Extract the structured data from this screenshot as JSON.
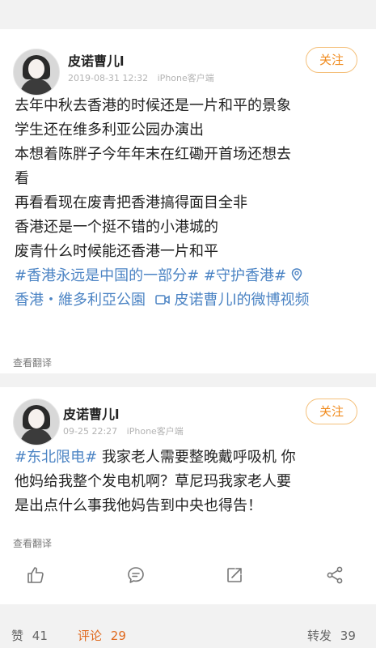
{
  "post1": {
    "username": "皮诺曹儿l",
    "timestamp": "2019-08-31 12:32",
    "client": "iPhone客户端",
    "follow_label": "关注",
    "lines": [
      "去年中秋去香港的时候还是一片和平的景象",
      "学生还在维多利亚公园办演出",
      "本想着陈胖子今年年末在红磡开首场还想去",
      "看",
      "再看看现在废青把香港搞得面目全非",
      "香港还是一个挺不错的小港城的",
      "废青什么时候能还香港一片和平"
    ],
    "tag1": "#香港永远是中国的一部分#",
    "tag2": "#守护香港#",
    "location": "香港・維多利亞公園",
    "video": "皮诺曹儿l的微博视频",
    "translate_label": "查看翻译",
    "icons": {
      "location": "location-pin-icon",
      "video": "video-icon"
    }
  },
  "post2": {
    "username": "皮诺曹儿l",
    "timestamp": "09-25 22:27",
    "client": "iPhone客户端",
    "follow_label": "关注",
    "tag": "#东北限电#",
    "line1_rest": " 我家老人需要整晚戴呼吸机 你",
    "line2": "他妈给我整个发电机啊？草尼玛我家老人要",
    "line3": "是出点什么事我他妈告到中央也得告！",
    "translate_label": "查看翻译",
    "icons": {
      "like": "thumbs-up-icon",
      "comment": "comment-icon",
      "repost": "repost-icon",
      "share": "share-icon"
    }
  },
  "footer": {
    "like_label": "赞",
    "like_count": "41",
    "comment_label": "评论",
    "comment_count": "29",
    "repost_label": "转发",
    "repost_count": "39"
  },
  "colors": {
    "accent": "#f08a1c",
    "link": "#4c84c4",
    "active_tab": "#e06a1f"
  }
}
